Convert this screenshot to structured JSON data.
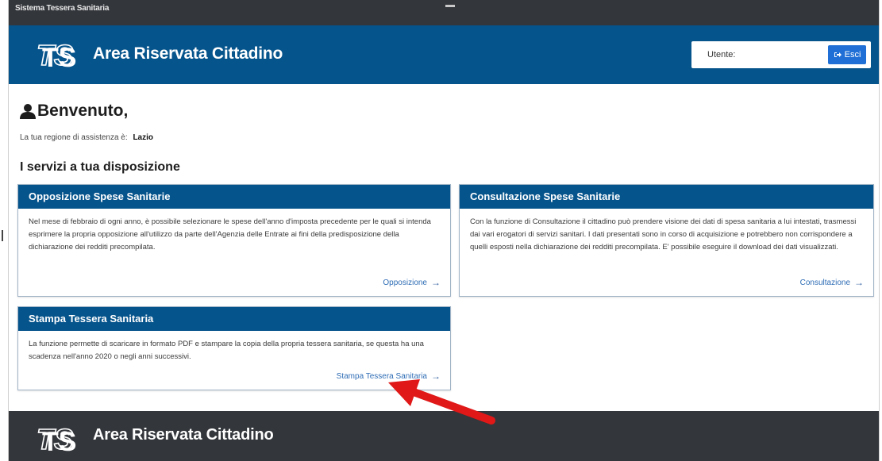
{
  "topbar": {
    "system_name": "Sistema Tessera Sanitaria"
  },
  "header": {
    "logo_text": "TS",
    "title": "Area Riservata Cittadino",
    "user_label": "Utente:",
    "exit_label": "Esci",
    "exit_icon": "sign-out-icon"
  },
  "welcome": {
    "icon": "user-icon",
    "title": "Benvenuto,",
    "region_label": "La tua regione di assistenza è:",
    "region_value": "Lazio"
  },
  "services": {
    "title": "I servizi a tua disposizione",
    "cards": [
      {
        "title": "Opposizione Spese Sanitarie",
        "text": "Nel mese di febbraio di ogni anno, è possibile selezionare le spese dell'anno d'imposta precedente per le quali si intenda esprimere la propria opposizione all'utilizzo da parte dell'Agenzia delle Entrate ai fini della predisposizione della dichiarazione dei redditi precompilata.",
        "link": "Opposizione"
      },
      {
        "title": "Consultazione Spese Sanitarie",
        "text": "Con la funzione di Consultazione il cittadino può prendere visione dei dati di spesa sanitaria a lui intestati, trasmessi dai vari erogatori di servizi sanitari. I dati presentati sono in corso di acquisizione e potrebbero non corrispondere a quelli esposti nella dichiarazione dei redditi precompilata. E' possibile eseguire il download dei dati visualizzati.",
        "link": "Consultazione"
      },
      {
        "title": "Stampa Tessera Sanitaria",
        "text": "La funzione permette di scaricare in formato PDF e stampare la copia della propria tessera sanitaria, se questa ha una scadenza nell'anno 2020 o negli anni successivi.",
        "link": "Stampa Tessera Sanitaria"
      }
    ]
  },
  "footer": {
    "logo_text": "TS",
    "title": "Area Riservata Cittadino"
  },
  "colors": {
    "brand_blue": "#06548c",
    "dark_bar": "#33363b",
    "button_blue": "#1f6fd6",
    "link_blue": "#2f6db5",
    "annotation_red": "#e01818"
  }
}
